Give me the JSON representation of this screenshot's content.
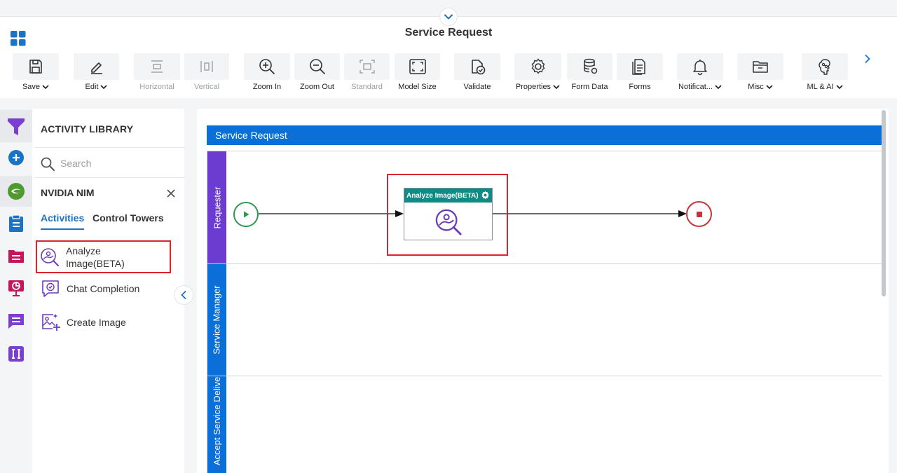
{
  "header": {
    "title": "Service Request"
  },
  "toolbar": {
    "save": "Save",
    "edit": "Edit",
    "horizontal": "Horizontal",
    "vertical": "Vertical",
    "zoom_in": "Zoom In",
    "zoom_out": "Zoom Out",
    "standard": "Standard",
    "model_size": "Model Size",
    "validate": "Validate",
    "properties": "Properties",
    "form_data": "Form Data",
    "forms": "Forms",
    "notifications": "Notificat...",
    "misc": "Misc",
    "ml_ai": "ML & AI"
  },
  "library": {
    "title": "ACTIVITY LIBRARY",
    "search_placeholder": "Search",
    "category": "NVIDIA NIM",
    "tabs": {
      "activities": "Activities",
      "control_towers": "Control Towers"
    },
    "items": [
      {
        "label": "Analyze Image(BETA)",
        "icon": "analyze-image-icon"
      },
      {
        "label": "Chat Completion",
        "icon": "chat-completion-icon"
      },
      {
        "label": "Create Image",
        "icon": "create-image-icon"
      }
    ]
  },
  "canvas": {
    "pool_title": "Service Request",
    "lanes": [
      "Requester",
      "Service Manager",
      "Accept Service Delivery"
    ],
    "task": {
      "label": "Analyze Image(BETA)"
    }
  },
  "colors": {
    "accent_blue": "#0a6fd6",
    "lane_purple": "#6b3ccf",
    "task_header_teal": "#0f8a84",
    "highlight_red": "#d9262c",
    "start_green": "#2e9a4f",
    "end_red": "#c8323a"
  }
}
